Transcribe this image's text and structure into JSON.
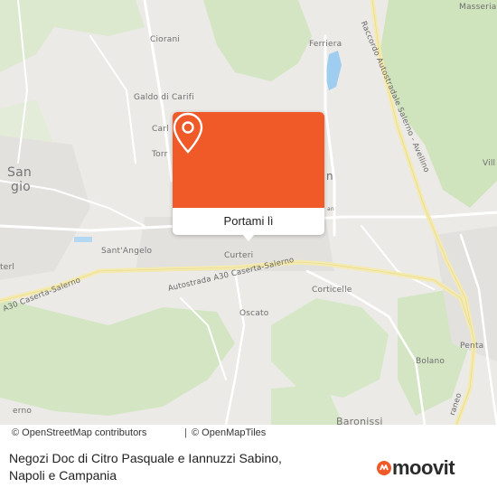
{
  "map": {
    "labels": {
      "masseria": "Masseria",
      "ciorani": "Ciorani",
      "ferriera": "Ferriera",
      "raccordo": "Raccordo Autostradale Salerno - Avellino",
      "galdo": "Galdo di Carifi",
      "carl": "Carl",
      "torr": "Torr",
      "san": "San",
      "gio": "gio",
      "vill": "Vill",
      "sant_angelo": "Sant'Angelo",
      "curteri": "Curteri",
      "terl": "terl",
      "a30_left": "A30 Caserta-Salerno",
      "a30_center": "Autostrada A30 Caserta-Salerno",
      "corticelle": "Corticelle",
      "oscato": "Oscato",
      "penta": "Penta",
      "bolano": "Bolano",
      "traneo": "raneo",
      "baronissi": "Baronissi",
      "erno": "erno",
      "small_a": "an",
      "small_b": "n"
    },
    "colors": {
      "land": "#eceae6",
      "green": "#cfe3bd",
      "road": "#ffffff",
      "motorway": "#f4eab0",
      "water": "#9fcdf0"
    }
  },
  "popup": {
    "button_label": "Portami lì",
    "accent": "#f05a28"
  },
  "attribution": {
    "osm_contributors": "© OpenStreetMap contributors",
    "separator": "|",
    "openmaptiles": "© OpenMapTiles"
  },
  "footer": {
    "title_line1": "Negozi Doc di Citro Pasquale e Iannuzzi Sabino,",
    "title_line2": "Napoli e Campania",
    "logo_text": "moovit"
  }
}
